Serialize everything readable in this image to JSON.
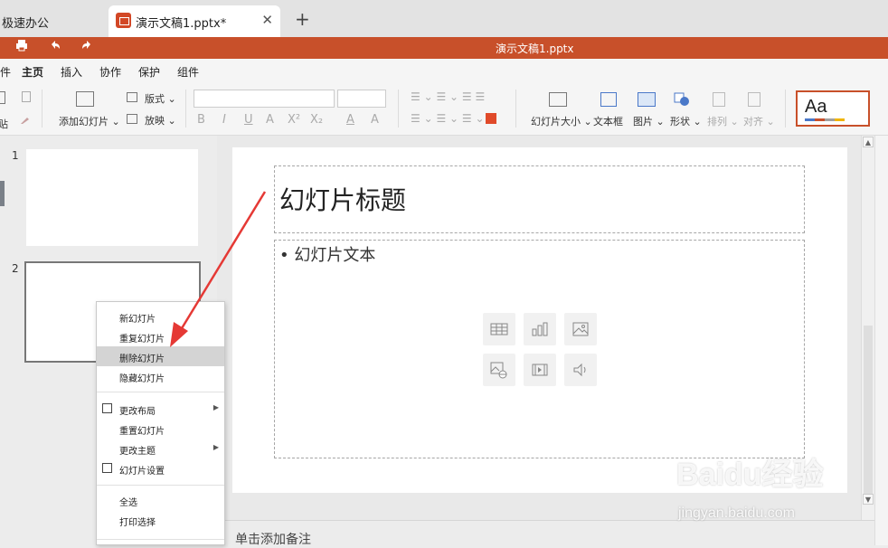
{
  "tabs": {
    "home": "极速办公",
    "doc": "演示文稿1.pptx*",
    "close": "✕",
    "new": "+"
  },
  "titlebar": {
    "title": "演示文稿1.pptx"
  },
  "menu": [
    "主页",
    "插入",
    "协作",
    "保护",
    "组件"
  ],
  "menu_left_fragment": "件",
  "ribbon": {
    "add_slide": "添加幻灯片",
    "layout": "版式",
    "play": "放映",
    "slide_size": "幻灯片大小",
    "textbox": "文本框",
    "picture": "图片",
    "shape": "形状",
    "arrange": "排列",
    "align": "对齐",
    "paste_fragment": "贴",
    "theme_sample": "Aa",
    "format_buttons": [
      "B",
      "I",
      "U",
      "A",
      "X²",
      "X₂",
      "A",
      "A"
    ]
  },
  "slides": {
    "num1": "1",
    "num2": "2"
  },
  "slide": {
    "title": "幻灯片标题",
    "body": "• 幻灯片文本"
  },
  "insert_icons": [
    "table-icon",
    "chart-icon",
    "image-icon",
    "online-image-icon",
    "video-icon",
    "audio-icon"
  ],
  "context_menu": {
    "items": [
      "新幻灯片",
      "重复幻灯片",
      "删除幻灯片",
      "隐藏幻灯片",
      "更改布局",
      "重置幻灯片",
      "更改主题",
      "幻灯片设置",
      "全选",
      "打印选择"
    ],
    "highlighted": "删除幻灯片"
  },
  "notes": "单击添加备注",
  "watermark": {
    "brand": "Baidu经验",
    "url": "jingyan.baidu.com"
  },
  "colors": {
    "accent": "#c8502a",
    "arrow": "#e53935"
  }
}
